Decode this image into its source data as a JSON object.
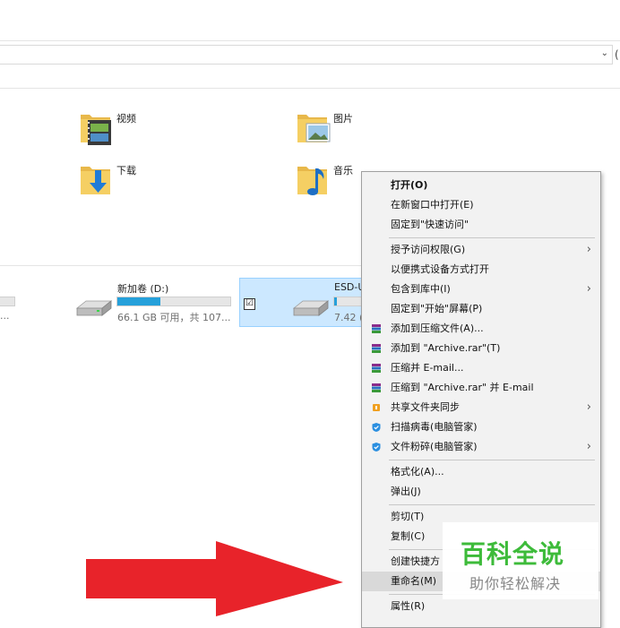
{
  "folders": [
    {
      "label": "视频",
      "icon": "video-folder-icon"
    },
    {
      "label": "图片",
      "icon": "pictures-folder-icon"
    },
    {
      "label": "下载",
      "icon": "downloads-folder-icon"
    },
    {
      "label": "音乐",
      "icon": "music-folder-icon"
    }
  ],
  "drives": {
    "d": {
      "name": "新加卷 (D:)",
      "size": "66.1 GB 可用，共 107...",
      "used_fraction": 0.38
    },
    "esd": {
      "name": "ESD-U",
      "size": "7.42 (",
      "used_fraction": 0.1
    },
    "left_partial": {
      "size": "..."
    }
  },
  "context_menu": {
    "items": [
      {
        "label": "打开(O)"
      },
      {
        "label": "在新窗口中打开(E)"
      },
      {
        "label": "固定到\"快速访问\""
      },
      {
        "label": "授予访问权限(G)"
      },
      {
        "label": "以便携式设备方式打开"
      },
      {
        "label": "包含到库中(I)"
      },
      {
        "label": "固定到\"开始\"屏幕(P)"
      },
      {
        "label": "添加到压缩文件(A)..."
      },
      {
        "label": "添加到 \"Archive.rar\"(T)"
      },
      {
        "label": "压缩并 E-mail..."
      },
      {
        "label": "压缩到 \"Archive.rar\" 并 E-mail"
      },
      {
        "label": "共享文件夹同步"
      },
      {
        "label": "扫描病毒(电脑管家)"
      },
      {
        "label": "文件粉碎(电脑管家)"
      },
      {
        "label": "格式化(A)..."
      },
      {
        "label": "弹出(J)"
      },
      {
        "label": "剪切(T)"
      },
      {
        "label": "复制(C)"
      },
      {
        "label": "创建快捷方"
      },
      {
        "label": "重命名(M)"
      },
      {
        "label": "属性(R)"
      }
    ],
    "submenu_glyph": "›"
  },
  "checkbox_glyph": "☑",
  "address_chevron": "⌄",
  "address_right_char": "(",
  "watermark": {
    "title": "百科全说",
    "subtitle": "助你轻松解决"
  },
  "colors": {
    "accent": "#26a0da",
    "selection": "#cce8ff",
    "arrow": "#e8232a",
    "watermark_green": "#3dbb3a"
  }
}
